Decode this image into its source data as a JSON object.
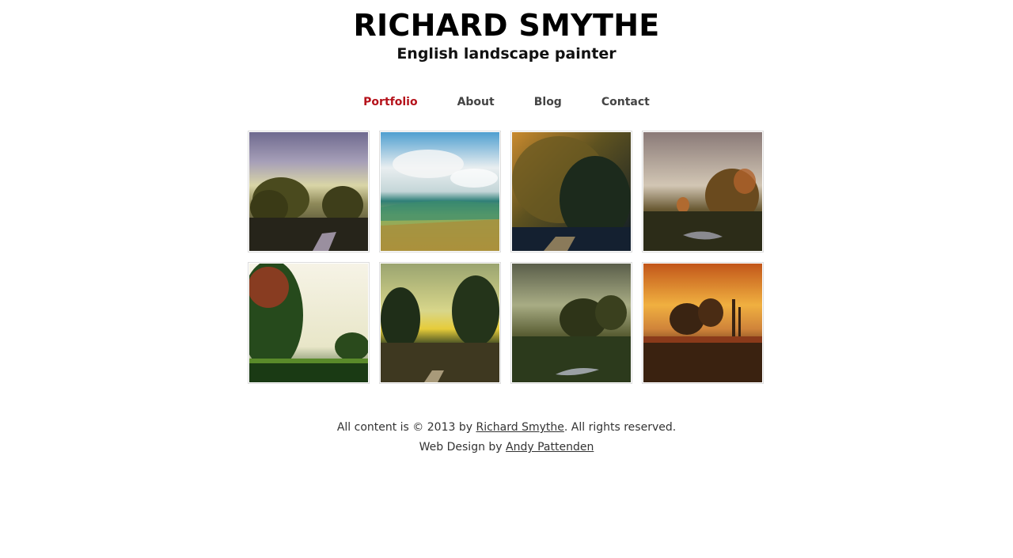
{
  "header": {
    "title": "RICHARD SMYTHE",
    "subtitle": "English landscape painter"
  },
  "nav": {
    "items": [
      {
        "label": "Portfolio",
        "active": true
      },
      {
        "label": "About",
        "active": false
      },
      {
        "label": "Blog",
        "active": false
      },
      {
        "label": "Contact",
        "active": false
      }
    ],
    "active_color": "#b5121b"
  },
  "gallery": {
    "items": [
      {
        "name": "painting-1",
        "palette": [
          "#8a7fa3",
          "#d8d2a8",
          "#4a4a2a",
          "#2a2a18"
        ]
      },
      {
        "name": "painting-2",
        "palette": [
          "#6fb2d6",
          "#e8eef0",
          "#3f8a7c",
          "#b5a24a"
        ]
      },
      {
        "name": "painting-3",
        "palette": [
          "#c98a2e",
          "#6b5a24",
          "#1f2a1e",
          "#0f1d2a"
        ]
      },
      {
        "name": "painting-4",
        "palette": [
          "#9a8d86",
          "#cfc3b5",
          "#5a4a2a",
          "#2c2a1a"
        ]
      },
      {
        "name": "painting-5",
        "palette": [
          "#f3f0e4",
          "#2e5a22",
          "#a8452a",
          "#14301a"
        ]
      },
      {
        "name": "painting-6",
        "palette": [
          "#b7c48a",
          "#e6d24a",
          "#2a3a22",
          "#4a4024"
        ]
      },
      {
        "name": "painting-7",
        "palette": [
          "#6a6e56",
          "#9aa07a",
          "#2a3018",
          "#3e4a24"
        ]
      },
      {
        "name": "painting-8",
        "palette": [
          "#e8a23a",
          "#c0641c",
          "#3a2210",
          "#6a2a14"
        ]
      }
    ]
  },
  "footer": {
    "line1_prefix": "All content is © 2013 by ",
    "line1_link": "Richard Smythe",
    "line1_suffix": ". All rights reserved.",
    "line2_prefix": "Web Design by ",
    "line2_link": "Andy Pattenden"
  }
}
